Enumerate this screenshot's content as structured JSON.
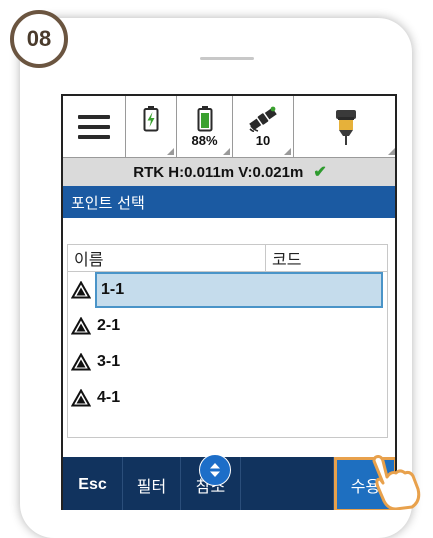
{
  "step": {
    "number": "08"
  },
  "status_bar": {
    "menu_icon": "hamburger-menu-icon",
    "battery_charging_icon": "battery-charging-icon",
    "battery_icon": "battery-icon",
    "battery_level": "88%",
    "satellite_icon": "satellite-icon",
    "satellite_count": "10",
    "receiver_icon": "gnss-receiver-icon"
  },
  "rtk": {
    "text": "RTK H:0.011m V:0.021m",
    "status_icon": "checkmark-icon",
    "status_color": "#2e9b2e"
  },
  "screen": {
    "title": "포인트 선택"
  },
  "list": {
    "columns": {
      "name": "이름",
      "code": "코드"
    },
    "rows": [
      {
        "name": "1-1",
        "icon": "survey-point-triangle-icon",
        "selected": true
      },
      {
        "name": "2-1",
        "icon": "survey-point-triangle-icon",
        "selected": false
      },
      {
        "name": "3-1",
        "icon": "survey-point-triangle-icon",
        "selected": false
      },
      {
        "name": "4-1",
        "icon": "survey-point-triangle-icon",
        "selected": false
      }
    ]
  },
  "soft_keys": {
    "esc": "Esc",
    "filter": "필터",
    "reference": "참조",
    "accept": "수용",
    "toggle_icon": "expand-collapse-icon"
  },
  "colors": {
    "title_bar": "#1b5aa2",
    "soft_key_bar": "#11335e",
    "accept_button": "#1e6fc0",
    "highlight_border": "#e8a14c",
    "selection_fill": "#c5dcec",
    "step_badge_border": "#6b5540"
  }
}
